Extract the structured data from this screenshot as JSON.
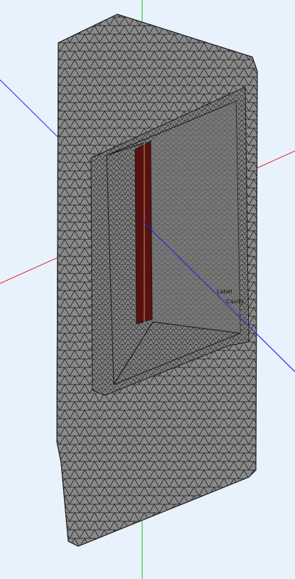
{
  "viewport": {
    "background": "#e8f2fc",
    "mesh_face_color": "#8a8a8a",
    "mesh_edge_color": "#1a1a1a",
    "slot_color": "#5a1010",
    "axes": [
      {
        "name": "x",
        "color": "#e0202a"
      },
      {
        "name": "y",
        "color": "#20c020"
      },
      {
        "name": "z",
        "color": "#2020e0"
      }
    ]
  },
  "annotations": {
    "label_1": "Label",
    "label_2": "Cavity"
  }
}
